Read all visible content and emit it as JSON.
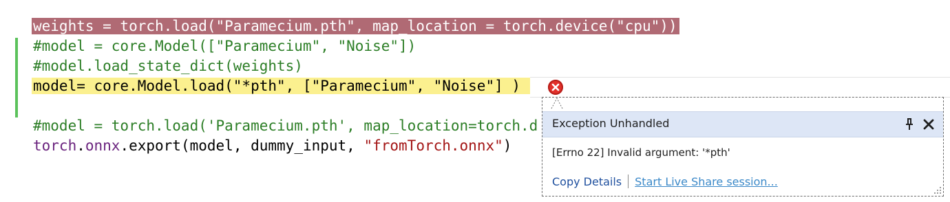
{
  "code_lines": [
    {
      "text": "weights = torch.load(\"Paramecium.pth\", map_location = torch.device(\"cpu\"))"
    },
    {
      "text": "#model = core.Model([\"Paramecium\", \"Noise\"])"
    },
    {
      "text": "#model.load_state_dict(weights)"
    },
    {
      "text": "model= core.Model.load(\"*pth\", [\"Paramecium\", \"Noise\"] )"
    },
    {
      "text": ""
    },
    {
      "text": "#model = torch.load('Paramecium.pth', map_location=torch.d"
    },
    {
      "parts": [
        "torch",
        ".",
        "onnx",
        ".export(model, dummy_input, ",
        "\"fromTorch.onnx\"",
        ")"
      ]
    }
  ],
  "exception": {
    "title": "Exception Unhandled",
    "message": "[Errno 22] Invalid argument: '*pth'",
    "copy_details": "Copy Details",
    "live_share": "Start Live Share session..."
  },
  "colors": {
    "highlight_red": "#b06a74",
    "highlight_yellow": "#fbf08f",
    "comment": "#2c7e26",
    "identifier": "#6a237e",
    "string": "#a31515",
    "change_bar": "#5bc25b",
    "error_icon": "#e2302a",
    "popup_header": "#dde6f6"
  },
  "icons": [
    "error-circle-icon",
    "pin-icon",
    "close-icon",
    "resize-grip-icon"
  ]
}
